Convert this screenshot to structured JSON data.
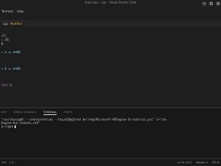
{
  "window": {
    "title": "main.cpp - cpp - Visual Studio Code"
  },
  "menu": [
    "Terminal",
    "Help"
  ],
  "editor": {
    "tab_label": ".cpp",
    "tab_status": "Modified",
    "lines": [
      {
        "text": "=5;"
      },
      {
        "text": "= 10;"
      },
      {
        "text": "B"
      },
      {
        "text": ""
      },
      {
        "text": "= a == and0;"
      },
      {
        "text": ""
      },
      {
        "text": "= b == and0;"
      },
      {
        "text": ""
      },
      {
        "text": "turn 0;"
      }
    ]
  },
  "panel": {
    "tabs": [
      "BUT",
      "DEBUG CONSOLE",
      "TERMINAL",
      "PORTS"
    ],
    "active_tab": "TERMINAL",
    "terminal_lines": [
      "\"/usr/bin/gdb\" --interpreter=mi --tty=${DbgTerm} 0<\"/tmp/Microsoft-MIEngine-In-tx4rrucc.pcc\" 1>\"/tm",
      "Engine-Out-2iduztu.xtd\"",
      "p~/cpp$ "
    ]
  },
  "status": {
    "left": [
      "⊗ 0",
      "⚠ 0"
    ],
    "right": [
      "Ln 19, Col 3",
      "Spaces: 4",
      "UTF-8"
    ]
  },
  "colors": {
    "background": "#1e1e1e",
    "panel": "#181818",
    "accent_modified": "#e6b450"
  }
}
